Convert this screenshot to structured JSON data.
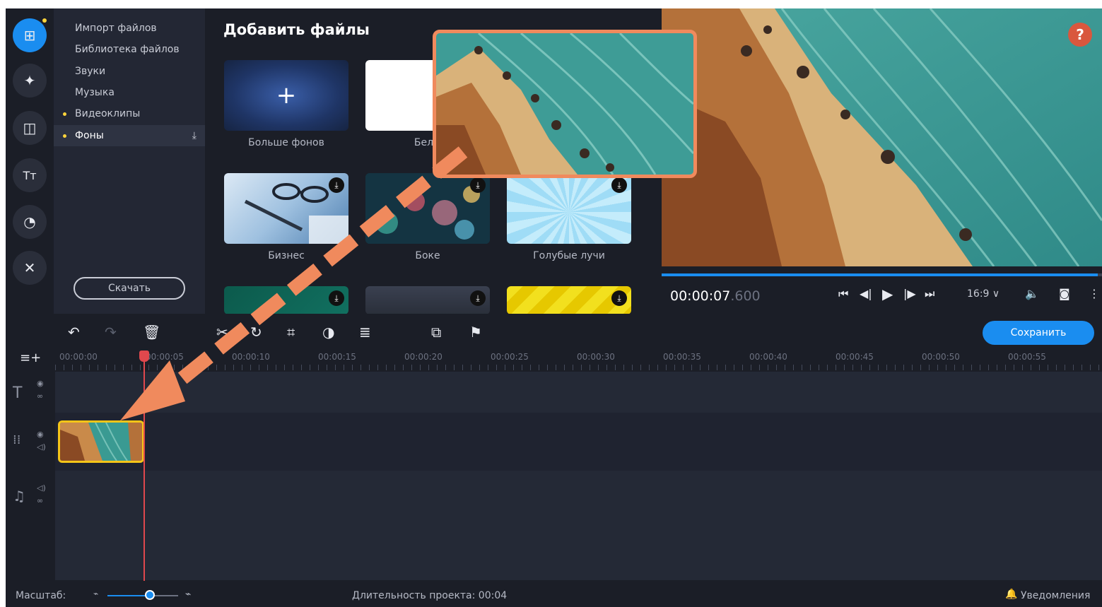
{
  "sidebar": {
    "tools": [
      {
        "icon": "import-icon",
        "glyph": "⊞"
      },
      {
        "icon": "magic-wand-icon",
        "glyph": "✦"
      },
      {
        "icon": "transitions-icon",
        "glyph": "◫"
      },
      {
        "icon": "titles-icon",
        "glyph": "Tт"
      },
      {
        "icon": "stickers-icon",
        "glyph": "◔"
      },
      {
        "icon": "tools-icon",
        "glyph": "✕"
      }
    ]
  },
  "menu": {
    "items": [
      {
        "label": "Импорт файлов"
      },
      {
        "label": "Библиотека файлов"
      },
      {
        "label": "Звуки"
      },
      {
        "label": "Музыка"
      },
      {
        "label": "Видеоклипы"
      },
      {
        "label": "Фоны"
      }
    ],
    "download_button": "Скачать"
  },
  "files": {
    "title": "Добавить файлы",
    "tiles": [
      {
        "label": "Больше фонов",
        "glyph": "+"
      },
      {
        "label": "Белы"
      },
      {
        "label": "Бизнес"
      },
      {
        "label": "Боке"
      },
      {
        "label": "Голубые лучи"
      }
    ]
  },
  "preview": {
    "help": "?",
    "timecode": "00:00:07",
    "timecode_ms": ".600",
    "progress": 0.99,
    "aspect_ratio": "16:9 ∨"
  },
  "toolbar": {
    "save_label": "Сохранить"
  },
  "ruler": {
    "labels": [
      "00:00:00",
      "00:00:05",
      "00:00:10",
      "00:00:15",
      "00:00:20",
      "00:00:25",
      "00:00:30",
      "00:00:35",
      "00:00:40",
      "00:00:45",
      "00:00:50",
      "00:00:55"
    ]
  },
  "status": {
    "scale_label": "Масштаб:",
    "zoom": 0.55,
    "duration": "Длительность проекта: 00:04",
    "notifications": "Уведомления"
  },
  "colors": {
    "accent": "#1a8df0",
    "highlight": "#f08a5d",
    "clip_border": "#f5c518",
    "playhead": "#e0484d"
  }
}
